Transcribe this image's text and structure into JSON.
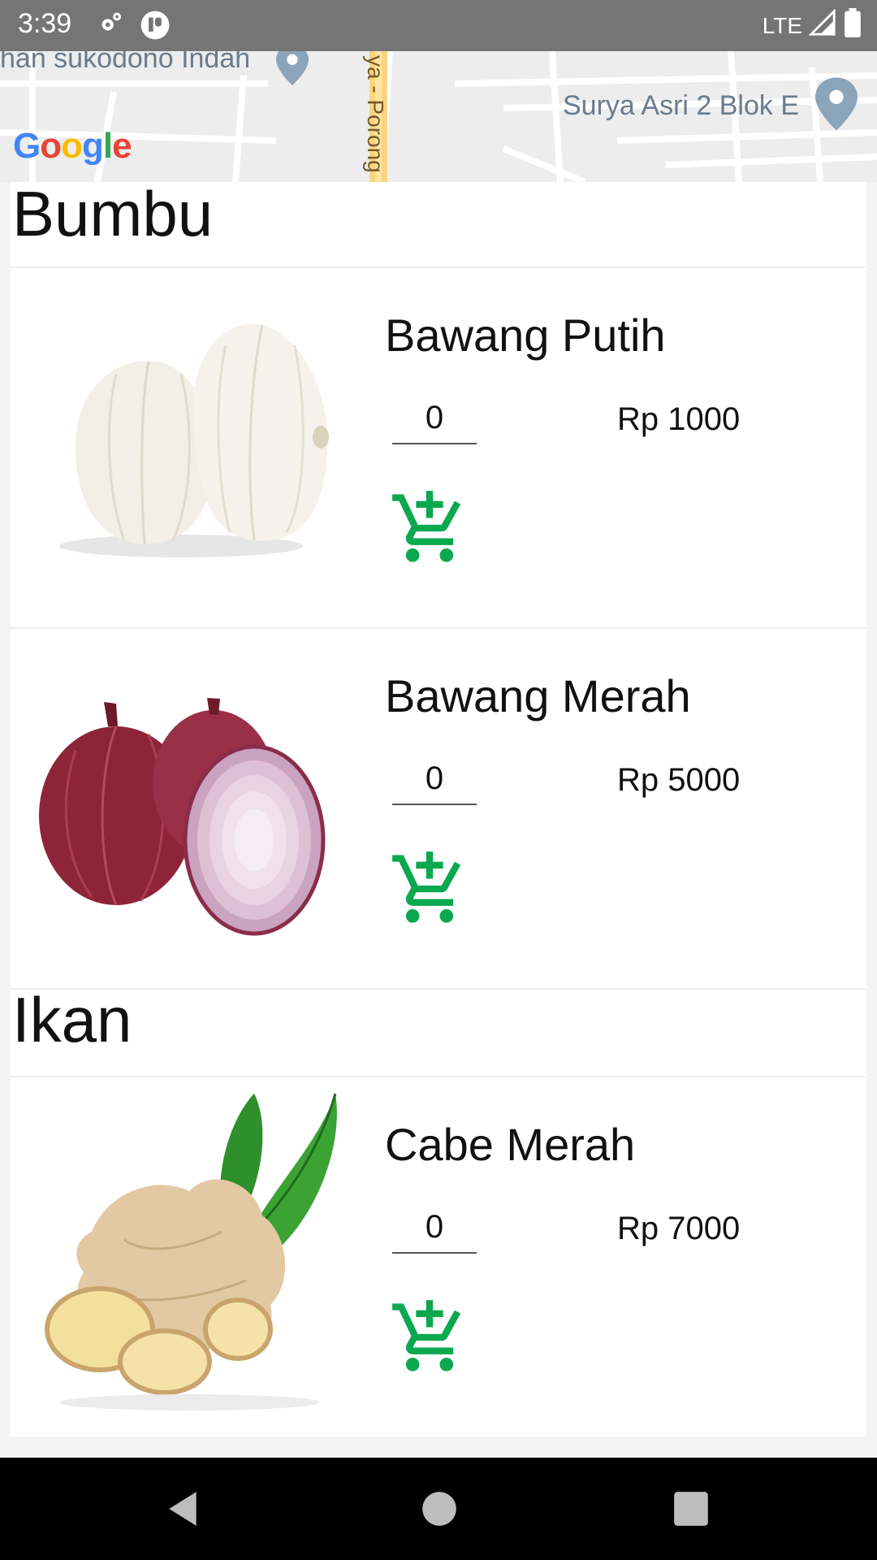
{
  "status_bar": {
    "time": "3:39",
    "network": "LTE",
    "icons": [
      "settings-icon",
      "app-notification-icon",
      "signal-icon",
      "battery-icon"
    ]
  },
  "map": {
    "labels": [
      "han sukodono Indah",
      "ya - Porong",
      "Surya Asri 2 Blok E"
    ],
    "logo": "Google"
  },
  "sections": [
    {
      "title": "Bumbu",
      "products": [
        {
          "name": "Bawang Putih",
          "qty": "0",
          "price": "Rp 1000",
          "image": "garlic"
        },
        {
          "name": "Bawang Merah",
          "qty": "0",
          "price": "Rp 5000",
          "image": "red-onion"
        }
      ]
    },
    {
      "title": "Ikan",
      "products": [
        {
          "name": "Cabe Merah",
          "qty": "0",
          "price": "Rp 7000",
          "image": "ginger"
        }
      ]
    }
  ],
  "colors": {
    "accent": "#0aa84f",
    "status_bar": "#757575",
    "nav_bar": "#000000"
  },
  "nav_bar": {
    "icons": [
      "back-icon",
      "home-icon",
      "recents-icon"
    ]
  }
}
